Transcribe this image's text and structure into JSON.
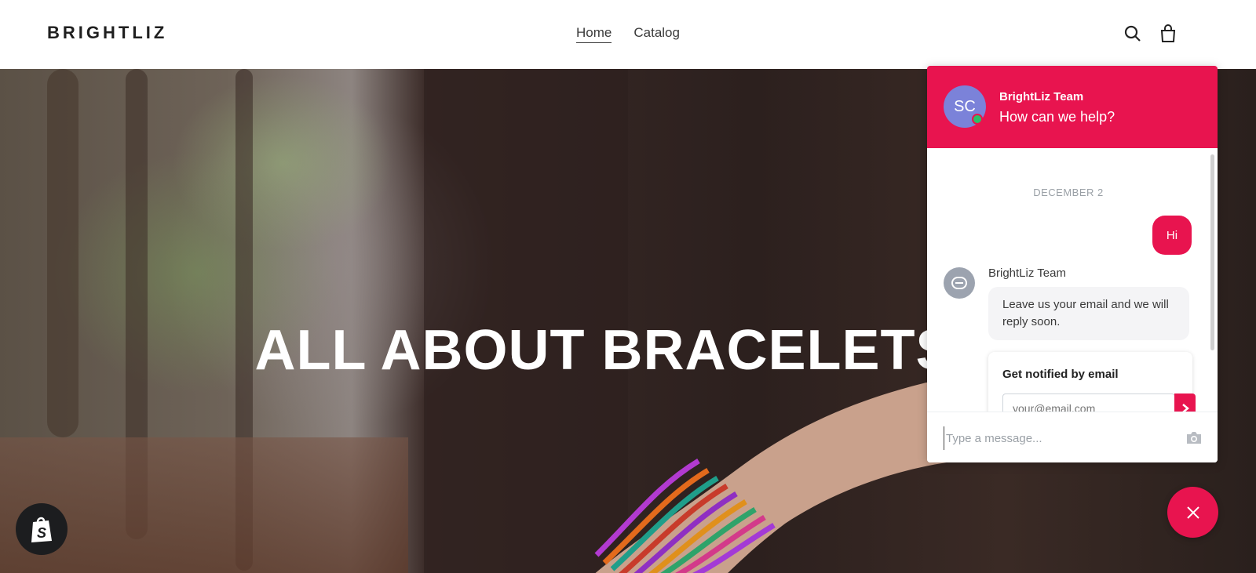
{
  "header": {
    "logo": "BRIGHTLIZ",
    "nav": [
      {
        "label": "Home",
        "active": true
      },
      {
        "label": "Catalog",
        "active": false
      }
    ],
    "icons": [
      "search-icon",
      "cart-icon"
    ]
  },
  "hero": {
    "title": "ALL ABOUT BRACELETS"
  },
  "chat": {
    "avatar_initials": "SC",
    "team_name": "BrightLiz Team",
    "subtitle": "How can we help?",
    "date": "DECEMBER 2",
    "messages": [
      {
        "from": "me",
        "text": "Hi"
      },
      {
        "from": "bot",
        "sender": "BrightLiz Team",
        "text": "Leave us your email and we will reply soon."
      }
    ],
    "notify": {
      "title": "Get notified by email",
      "email_placeholder": "your@email.com"
    },
    "input_placeholder": "Type a message...",
    "accent": "#e8144f",
    "online_color": "#2bbf68"
  },
  "badges": {
    "shopify": "shopify-icon"
  }
}
